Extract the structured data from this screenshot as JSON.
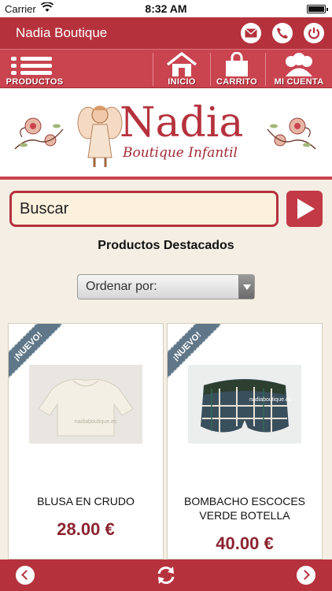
{
  "status_bar": {
    "carrier": "Carrier",
    "time": "8:32 AM"
  },
  "header": {
    "title": "Nadia Boutique",
    "actions": [
      {
        "icon": "mail-icon"
      },
      {
        "icon": "phone-icon"
      },
      {
        "icon": "power-icon"
      }
    ]
  },
  "nav": {
    "products_label": "PRODUCTOS",
    "home_label": "INICIO",
    "cart_label": "CARRITO",
    "account_label": "MI CUENTA"
  },
  "logo": {
    "name": "Nadia",
    "tagline": "Boutique Infantil"
  },
  "search": {
    "placeholder": "Buscar"
  },
  "section_title": "Productos Destacados",
  "sort": {
    "label": "Ordenar por:"
  },
  "products": [
    {
      "badge": "¡NUEVO!",
      "name": "BLUSA EN CRUDO",
      "price": "28.00 €",
      "watermark": "nadiaboutique.es"
    },
    {
      "badge": "¡NUEVO!",
      "name": "BOMBACHO ESCOCES VERDE BOTELLA",
      "price": "40.00 €",
      "watermark": "nadiaboutique.es"
    }
  ],
  "colors": {
    "brand_red": "#b5323d",
    "nav_red": "#c9444f",
    "badge_blue": "#5f7788",
    "price_red": "#8c2430",
    "background": "#f4eee4"
  }
}
